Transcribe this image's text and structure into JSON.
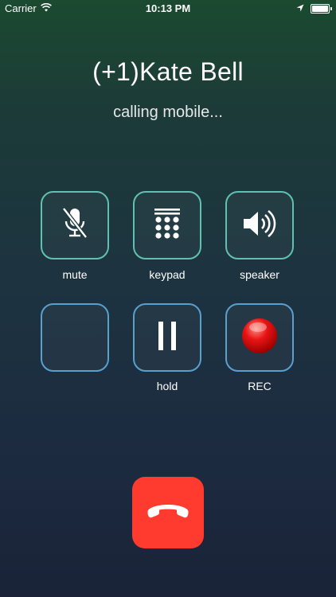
{
  "status_bar": {
    "carrier": "Carrier",
    "time": "10:13 PM",
    "battery_level": 1.0
  },
  "call": {
    "caller_name": "(+1)Kate Bell",
    "status": "calling mobile..."
  },
  "controls": {
    "mute_label": "mute",
    "keypad_label": "keypad",
    "speaker_label": "speaker",
    "empty_label": "",
    "hold_label": "hold",
    "rec_label": "REC"
  },
  "icons": {
    "wifi": "wifi-icon",
    "location": "location-arrow-icon",
    "battery": "battery-icon",
    "mute": "microphone-off-icon",
    "keypad": "keypad-grid-icon",
    "speaker": "speaker-volume-icon",
    "hold": "pause-icon",
    "rec": "record-dot-icon",
    "end_call": "phone-hangup-icon"
  },
  "colors": {
    "row1_border": "#5fc2b0",
    "row2_border": "#5aa0cf",
    "end_call": "#ff3b30",
    "rec_dot": "#e01010"
  }
}
